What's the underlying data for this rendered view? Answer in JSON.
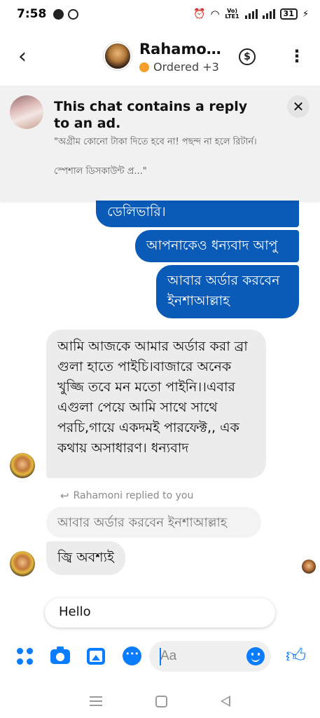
{
  "status_bar": {
    "time": "7:58",
    "battery": "31",
    "volte_label": "Vo) LTE1"
  },
  "header": {
    "contact_name": "Rahamo…",
    "status_text": "Ordered +3",
    "status_color": "#f59e2b",
    "back_icon": "chevron-left-icon",
    "dollar_icon": "dollar-circle-icon",
    "more_icon": "kebab-menu-icon"
  },
  "ad_banner": {
    "title": "This chat contains a reply to an ad.",
    "quote": "\"অগ্রীম কোনো টাকা দিতে হবে না!  পছন্দ না হলে রিটার্ন।\n\nস্পেশাল ডিসকাউন্ট প্র...\"",
    "close_label": "✕"
  },
  "messages": {
    "out_1": "ডেলিভারি।",
    "out_2": "আপনাকেও ধন্যবাদ আপু",
    "out_3": "আবার অর্ডার করবেন ইনশাআল্লাহ",
    "in_1": "আমি আজকে আমার অর্ডার করা ব্রা গুলা হাতে পাইচি।বাজারে অনেক খুজ্জি তবে মন মতো পাইনি।।এবার এগুলা পেয়ে আমি সাথে সাথে পরচি,গায়ে একদমই পারফেক্ট,, এক কথায় অসাধারণ। ধন্যবাদ",
    "reply_label": "Rahamoni replied to you",
    "reply_quote": "আবার অর্ডার করবেন ইনশাআল্লাহ",
    "in_2": "জ্বি অবশ্যই",
    "draft": "Hello"
  },
  "composer": {
    "placeholder": "Aa",
    "accent_color": "#0a7cff",
    "icons": [
      "apps-icon",
      "camera-icon",
      "gallery-icon",
      "chat-bubble-icon",
      "emoji-icon",
      "thumbs-up-icon"
    ]
  },
  "colors": {
    "outgoing_bubble": "#0a5ab8",
    "incoming_bubble": "#ececec"
  }
}
